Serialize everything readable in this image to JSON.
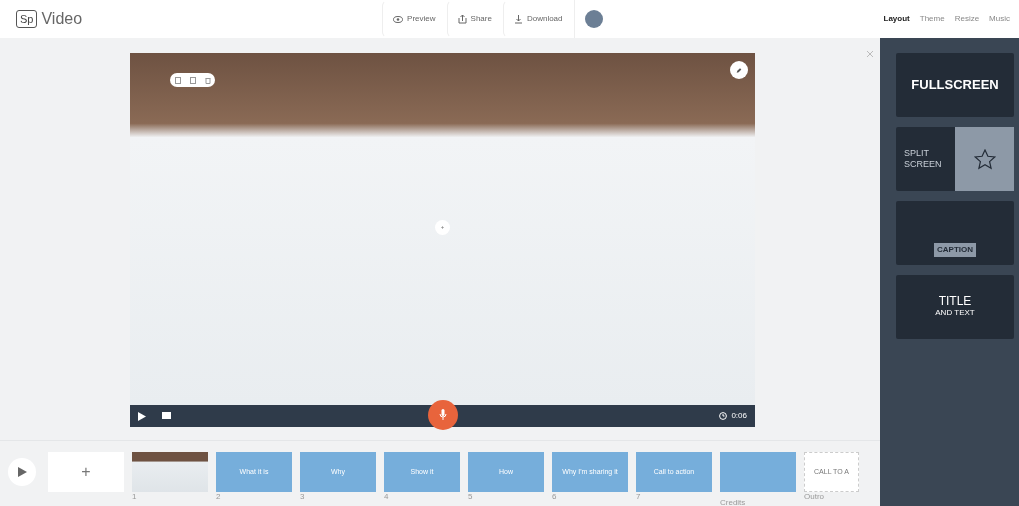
{
  "app": {
    "logo": "Sp",
    "title": "Video"
  },
  "toolbar": [
    {
      "kind": "preview",
      "label": "Preview"
    },
    {
      "kind": "share",
      "label": "Share"
    },
    {
      "kind": "download",
      "label": "Download"
    }
  ],
  "panel_tabs": [
    {
      "label": "Layout",
      "selected": true
    },
    {
      "label": "Theme",
      "selected": false
    },
    {
      "label": "Resize",
      "selected": false
    },
    {
      "label": "Music",
      "selected": false
    }
  ],
  "player": {
    "time": "0:06"
  },
  "layouts": [
    {
      "kind": "fullscreen",
      "title": "FULLSCREEN"
    },
    {
      "kind": "split",
      "title": "SPLIT SCREEN"
    },
    {
      "kind": "caption",
      "title": "CAPTION"
    },
    {
      "kind": "title",
      "title": "TITLE",
      "subtitle": "AND TEXT"
    }
  ],
  "slides": [
    {
      "kind": "add",
      "label": "+"
    },
    {
      "kind": "video",
      "number": "1"
    },
    {
      "kind": "text",
      "label": "What it is",
      "number": "2"
    },
    {
      "kind": "text",
      "label": "Why",
      "number": "3"
    },
    {
      "kind": "text",
      "label": "Show it",
      "number": "4"
    },
    {
      "kind": "text",
      "label": "How",
      "number": "5"
    },
    {
      "kind": "text",
      "label": "Why I'm sharing it",
      "number": "6"
    },
    {
      "kind": "text",
      "label": "Call to action",
      "number": "7"
    },
    {
      "kind": "text",
      "number": "Credits"
    },
    {
      "kind": "outro",
      "label": "CALL TO A",
      "number": "Outro"
    }
  ]
}
